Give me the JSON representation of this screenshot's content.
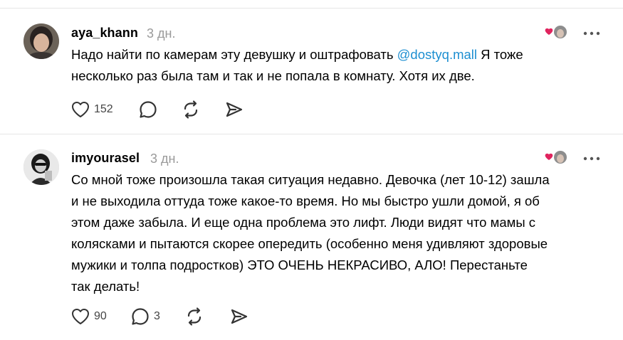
{
  "colors": {
    "mention": "#1d8fd1",
    "muted": "#9a9a9a",
    "heart_red": "#e0245e",
    "divider": "#e6e6e6"
  },
  "posts": [
    {
      "username": "aya_khann",
      "time": "3 дн.",
      "body_lines": [
        {
          "text": "Надо найти по камерам эту девушку и оштрафовать ",
          "mention": "@dostyq.mall",
          "after": " Я тоже"
        },
        {
          "text": "несколько раз была там и так и не попала в комнату. Хотя их две."
        }
      ],
      "likes": "152",
      "replies": ""
    },
    {
      "username": "imyourasel",
      "time": "3 дн.",
      "body_lines": [
        {
          "text": "Со мной тоже произошла такая ситуация недавно. Девочка (лет 10-12) зашла"
        },
        {
          "text": "и не выходила оттуда тоже какое-то время. Но мы быстро ушли домой, я об"
        },
        {
          "text": "этом даже забыла. И еще одна проблема это лифт. Люди видят что мамы с"
        },
        {
          "text": "колясками и пытаются скорее опередить (особенно меня удивляют здоровые"
        },
        {
          "text": "мужики и толпа подростков) ЭТО ОЧЕНЬ НЕКРАСИВО, АЛО! Перестаньте"
        },
        {
          "text": "так делать!"
        }
      ],
      "likes": "90",
      "replies": "3"
    }
  ],
  "icons": {
    "like": "heart-outline-icon",
    "reply": "speech-bubble-icon",
    "repost": "repost-arrows-icon",
    "share": "send-paper-plane-icon",
    "more": "three-dots-icon"
  }
}
